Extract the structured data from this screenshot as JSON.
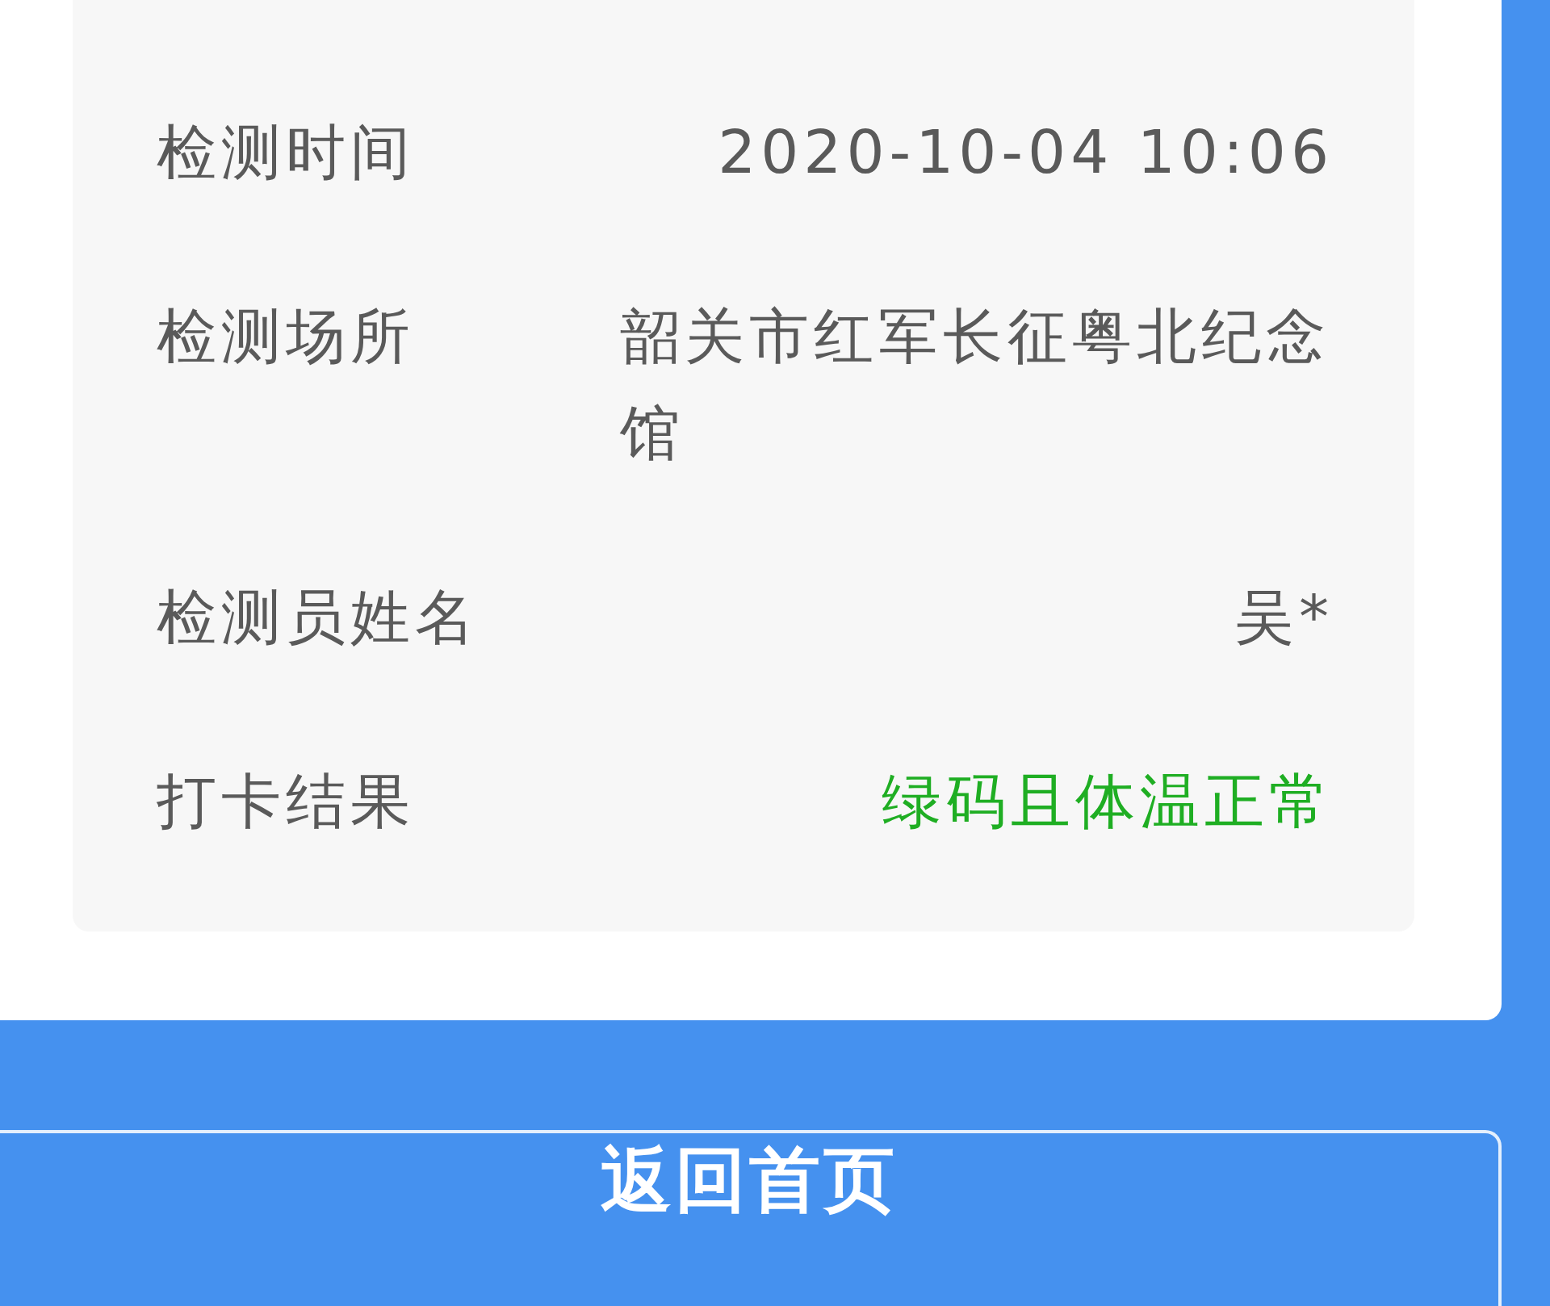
{
  "details": [
    {
      "label": "检测时间",
      "value": "2020-10-04 10:06",
      "kind": "plain"
    },
    {
      "label": "检测场所",
      "value": "韶关市红军长征粤北纪念馆",
      "kind": "plain"
    },
    {
      "label": "检测员姓名",
      "value": "吴*",
      "kind": "plain"
    },
    {
      "label": "打卡结果",
      "value": "绿码且体温正常",
      "kind": "ok"
    }
  ],
  "button": "返回首页"
}
